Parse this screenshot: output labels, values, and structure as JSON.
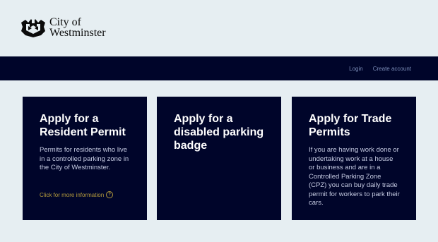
{
  "header": {
    "logo_line1": "City of",
    "logo_line2": "Westminster",
    "logo_icon": "westminster-crest-icon"
  },
  "nav": {
    "login": "Login",
    "create_account": "Create account"
  },
  "cards": [
    {
      "title": "Apply for a Resident Permit",
      "body": "Permits for residents who live in a controlled parking zone in the City of Westminster.",
      "link": "Click for more information",
      "link_icon": "question-icon"
    },
    {
      "title": "Apply for a disabled parking badge",
      "body": ""
    },
    {
      "title": "Apply for Trade Permits",
      "body": "If you are having work done or undertaking work at a house or business and are in a Controlled Parking Zone (CPZ) you can buy daily trade permit for workers to park their cars."
    }
  ],
  "colors": {
    "page_background": "#e6eef2",
    "navy": "#00052a",
    "link_gold": "#b49b3c"
  }
}
